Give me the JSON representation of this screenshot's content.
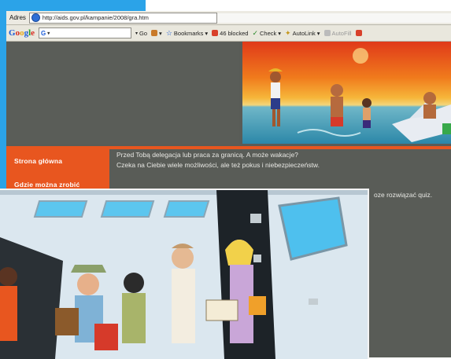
{
  "address_bar": {
    "label": "Adres",
    "url": "http://aids.gov.pl/kampanie/2008/gra.htm"
  },
  "google_toolbar": {
    "logo": "Google",
    "search_prefix": "G",
    "go_label": "Go",
    "bookmarks_label": "Bookmarks",
    "blocked_label": "46 blocked",
    "check_label": "Check",
    "autolink_label": "AutoLink",
    "autofill_label": "AutoFill"
  },
  "nav": {
    "items": [
      {
        "label": "Strona główna"
      },
      {
        "label": "Gdzie można zrobić"
      }
    ]
  },
  "content": {
    "line1": "Przed Tobą delegacja lub praca za granicą. A może wakacje?",
    "line2": "Czeka na Ciebie wiele możliwości, ale też pokus i niebezpieczeństw.",
    "line3": "oze rozwiązać quiz."
  },
  "colors": {
    "accent": "#e8561f",
    "page_bg": "#595c57",
    "chrome_blue": "#2ba3e8"
  }
}
